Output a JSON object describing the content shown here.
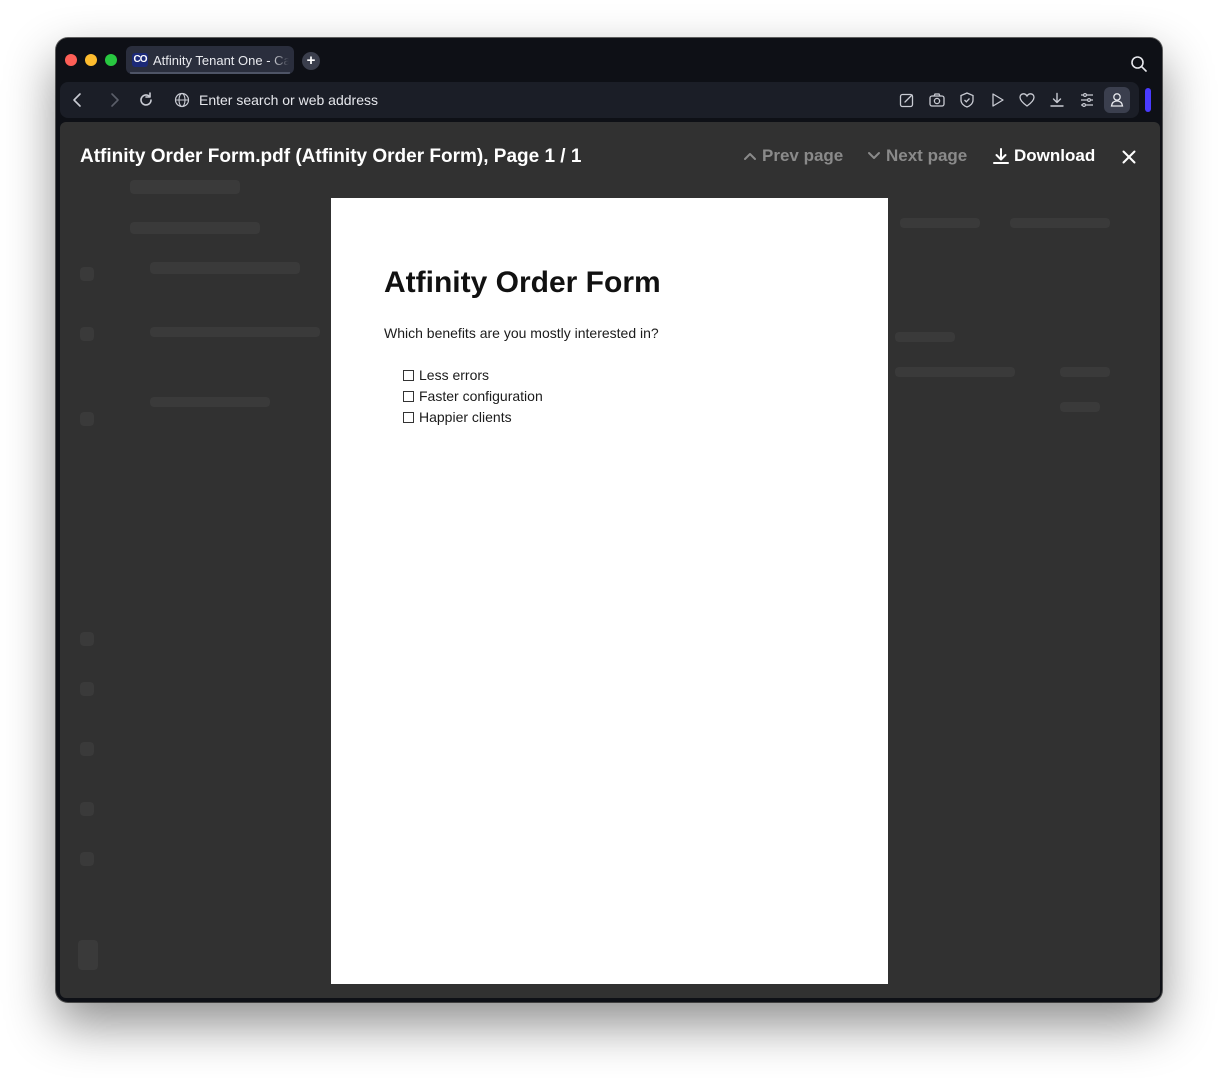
{
  "browser": {
    "tab": {
      "title": "Atfinity Tenant One - Case",
      "favicon": "atfinity-logo-icon"
    },
    "new_tab": "+",
    "address_bar": {
      "placeholder": "Enter search or web address"
    },
    "toolbar_icons": [
      "edit-icon",
      "camera-icon",
      "shield-icon",
      "play-icon",
      "heart-icon",
      "download-icon",
      "menu-icon",
      "profile-icon"
    ],
    "accent_color": "#4a3bff"
  },
  "viewer": {
    "title": "Atfinity Order Form.pdf (Atfinity Order Form), Page 1 / 1",
    "prev_label": "Prev page",
    "next_label": "Next page",
    "download_label": "Download"
  },
  "document": {
    "title": "Atfinity Order Form",
    "question": "Which benefits are you mostly interested in?",
    "options": [
      "Less errors",
      "Faster configuration",
      "Happier clients"
    ]
  }
}
